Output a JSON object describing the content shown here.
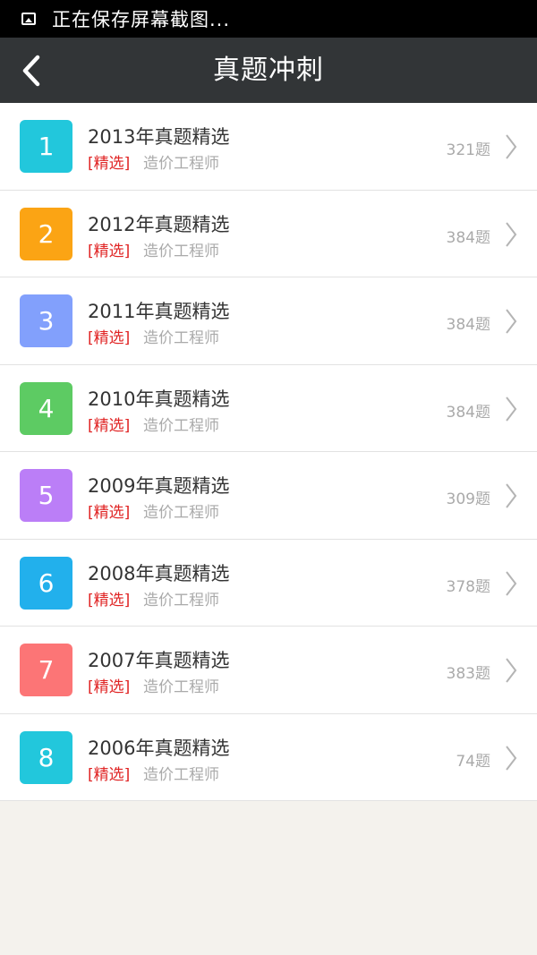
{
  "status_bar": {
    "icon": "image-icon",
    "text": "正在保存屏幕截图..."
  },
  "header": {
    "back_icon": "chevron-left-icon",
    "title": "真题冲刺"
  },
  "items": [
    {
      "number": "1",
      "title": "2013年真题精选",
      "tag": "[精选]",
      "category": "造价工程师",
      "count": "321题",
      "color": "#22c7dc"
    },
    {
      "number": "2",
      "title": "2012年真题精选",
      "tag": "[精选]",
      "category": "造价工程师",
      "count": "384题",
      "color": "#fba414"
    },
    {
      "number": "3",
      "title": "2011年真题精选",
      "tag": "[精选]",
      "category": "造价工程师",
      "count": "384题",
      "color": "#82a0fc"
    },
    {
      "number": "4",
      "title": "2010年真题精选",
      "tag": "[精选]",
      "category": "造价工程师",
      "count": "384题",
      "color": "#5dcb63"
    },
    {
      "number": "5",
      "title": "2009年真题精选",
      "tag": "[精选]",
      "category": "造价工程师",
      "count": "309题",
      "color": "#bb7ef7"
    },
    {
      "number": "6",
      "title": "2008年真题精选",
      "tag": "[精选]",
      "category": "造价工程师",
      "count": "378题",
      "color": "#22b0ec"
    },
    {
      "number": "7",
      "title": "2007年真题精选",
      "tag": "[精选]",
      "category": "造价工程师",
      "count": "383题",
      "color": "#fc7576"
    },
    {
      "number": "8",
      "title": "2006年真题精选",
      "tag": "[精选]",
      "category": "造价工程师",
      "count": "74题",
      "color": "#22c7dc"
    }
  ]
}
